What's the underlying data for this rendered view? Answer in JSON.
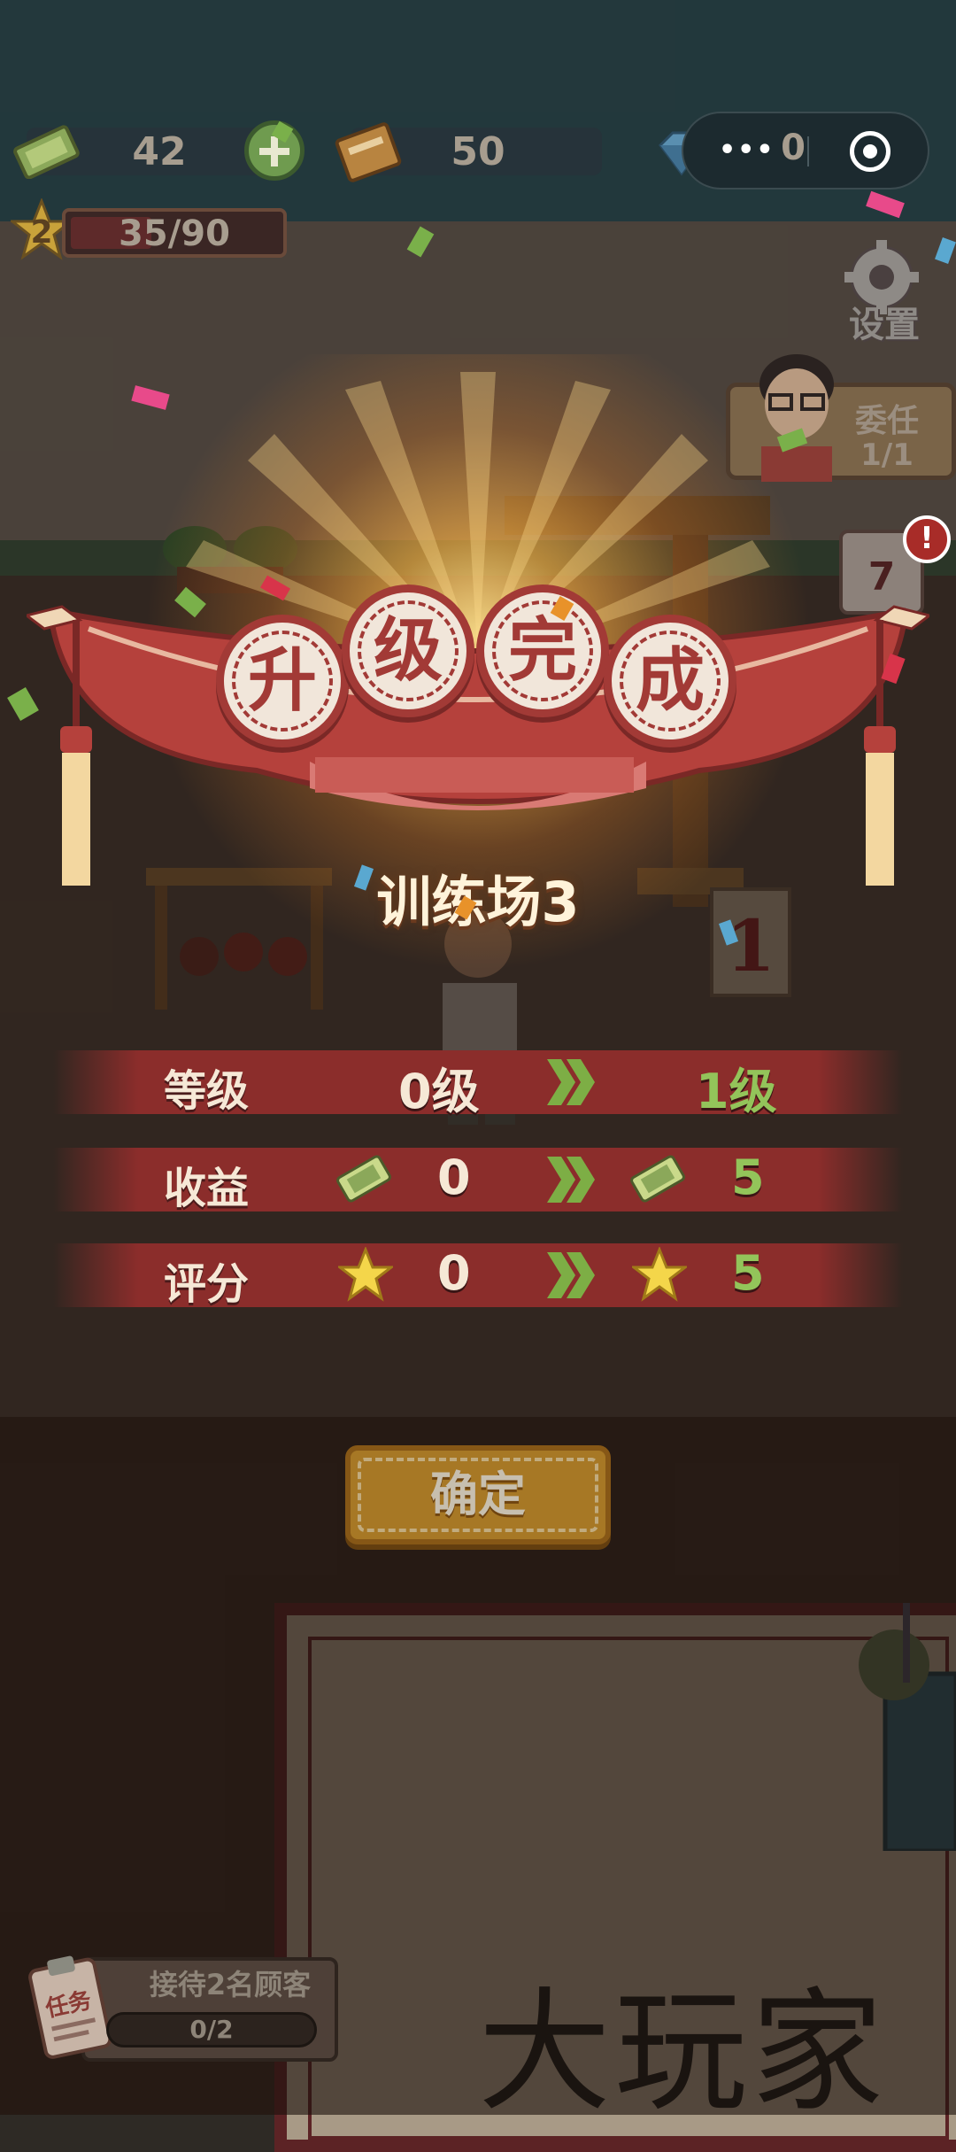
{
  "hud": {
    "cash": "42",
    "books": "50",
    "gems": "0",
    "level": "2",
    "xp_text": "35/90",
    "xp_fraction": 0.389
  },
  "miniprogram": {
    "dots": "•••"
  },
  "settings": {
    "label": "设置"
  },
  "commission": {
    "title": "委任",
    "count": "1/1"
  },
  "calendar": {
    "day": "7",
    "badge": "!"
  },
  "upgrade": {
    "title_chars": [
      "升",
      "级",
      "完",
      "成"
    ],
    "building_name": "训练场3",
    "rows": [
      {
        "label": "等级",
        "old": "0级",
        "new": "1级",
        "icon": ""
      },
      {
        "label": "收益",
        "old": "0",
        "new": "5",
        "icon": "cash-icon"
      },
      {
        "label": "评分",
        "old": "0",
        "new": "5",
        "icon": "star-icon"
      }
    ],
    "confirm_label": "确定"
  },
  "quest": {
    "badge": "任务",
    "title": "接待2名顾客",
    "progress_text": "0/2",
    "progress_fraction": 0
  },
  "watermark": "大玩家",
  "colors": {
    "accent_red": "#8b2d2b",
    "new_value_green": "#93c45a",
    "confirm_gold": "#d59a2e"
  }
}
